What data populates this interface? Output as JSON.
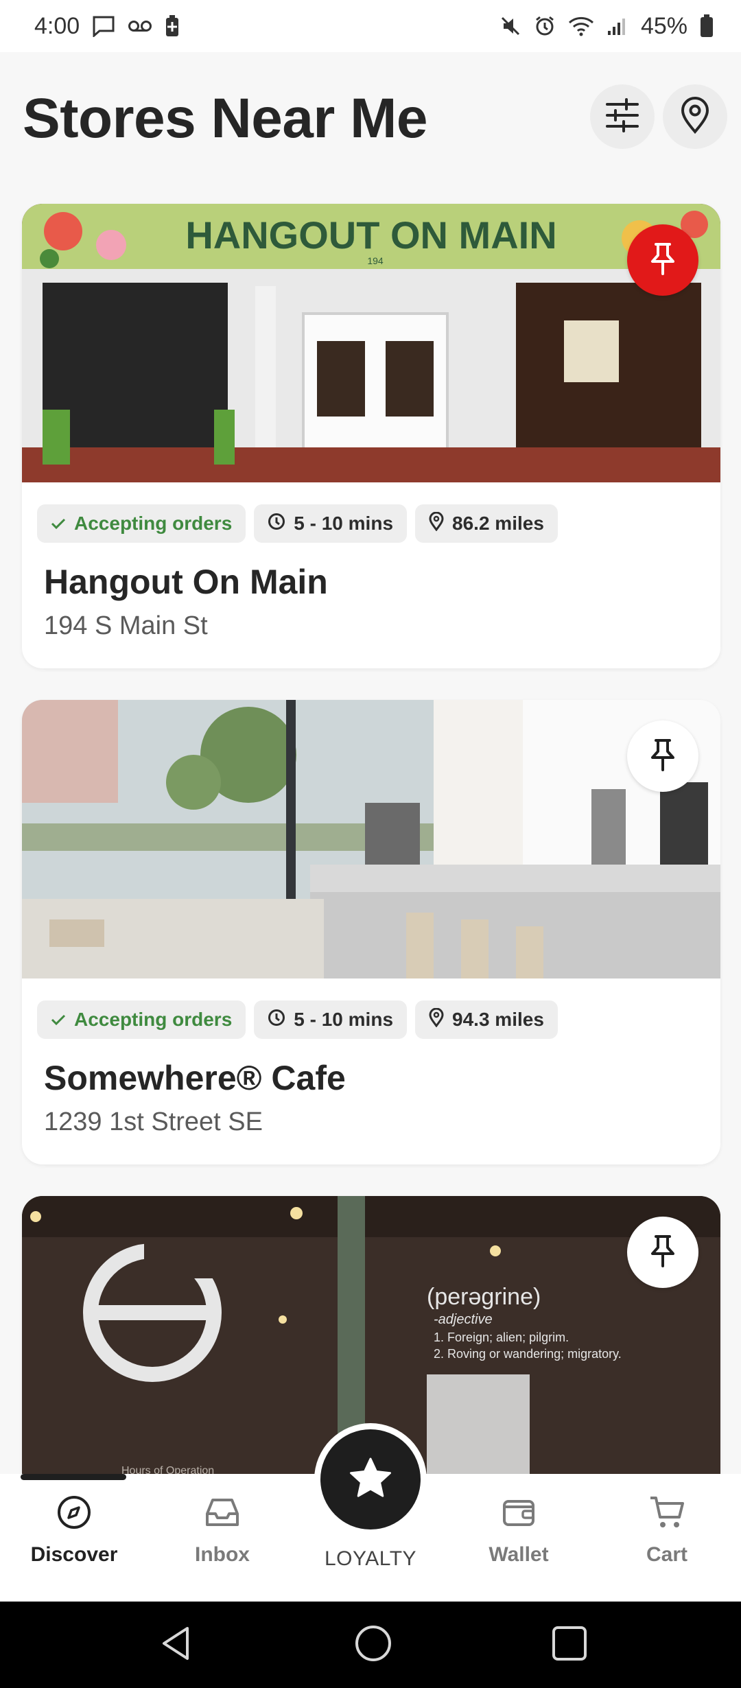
{
  "status_bar": {
    "time": "4:00",
    "battery": "45%"
  },
  "header": {
    "title": "Stores Near Me"
  },
  "stores": [
    {
      "name": "Hangout On Main",
      "address": "194 S Main St",
      "status": "Accepting orders",
      "wait": "5 - 10 mins",
      "distance": "86.2 miles",
      "pinned": true,
      "sign_text": "HANGOUT ON MAIN",
      "sign_number": "194"
    },
    {
      "name": "Somewhere® Cafe",
      "address": "1239 1st Street SE",
      "status": "Accepting orders",
      "wait": "5 - 10 mins",
      "distance": "94.3 miles",
      "pinned": false
    },
    {
      "name": "",
      "pinned": false,
      "sign_text": "(perəgrine)",
      "sign_sub": "-adjective",
      "sign_def1": "1. Foreign; alien; pilgrim.",
      "sign_def2": "2. Roving or wandering; migratory.",
      "sign_hours": "Hours of Operation"
    }
  ],
  "bottom_nav": {
    "items": [
      {
        "label": "Discover",
        "icon": "compass-icon",
        "active": true
      },
      {
        "label": "Inbox",
        "icon": "inbox-icon",
        "active": false
      },
      {
        "label": "LOYALTY",
        "icon": "star-icon",
        "active": false
      },
      {
        "label": "Wallet",
        "icon": "wallet-icon",
        "active": false
      },
      {
        "label": "Cart",
        "icon": "cart-icon",
        "active": false
      }
    ]
  },
  "colors": {
    "accent_red": "#e11919",
    "accepting_green": "#3f8a3f",
    "dark": "#1e1e1e"
  }
}
